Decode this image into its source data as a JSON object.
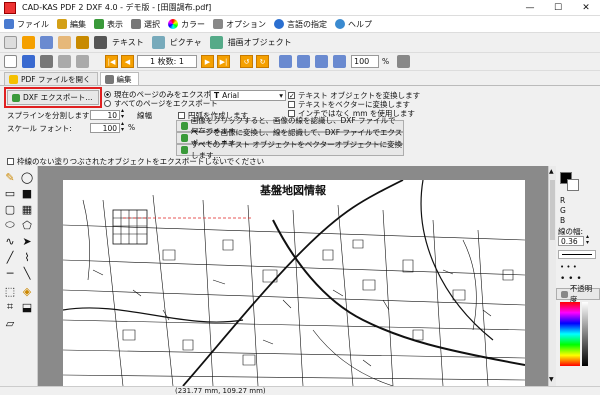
{
  "window": {
    "title": "CAD-KAS PDF 2 DXF 4.0 - デモ版 - [田園調布.pdf]",
    "minimize": "—",
    "maximize": "☐",
    "close": "✕"
  },
  "menu": [
    {
      "label": "ファイル",
      "color": "#4a7bd0"
    },
    {
      "label": "編集",
      "color": "#d4a017"
    },
    {
      "label": "表示",
      "color": "#3a9a3a"
    },
    {
      "label": "選択",
      "color": "#777777"
    },
    {
      "label": "カラー",
      "color": "#d04a4a"
    },
    {
      "label": "オプション",
      "color": "#888888"
    },
    {
      "label": "言語の指定",
      "color": "#2b6fd0"
    },
    {
      "label": "ヘルプ",
      "color": "#3a8ad0"
    }
  ],
  "toolbar1": {
    "text_label": "テキスト",
    "picture_label": "ピクチャ",
    "draw_object_label": "描画オブジェクト"
  },
  "toolbar2": {
    "page_indicator": "1 枚数: 1",
    "zoom": "100",
    "zoom_unit": "%"
  },
  "tabs": [
    {
      "label": "PDF ファイルを開く"
    },
    {
      "label": "編集"
    }
  ],
  "export_panel": {
    "dxf_export_button": "DXF エクスポート...",
    "radio_current_page": "現在のページのみをエクスポートします",
    "radio_all_pages": "すべてのページをエクスポート",
    "spline_label": "スプラインを分割します:",
    "spline_value": "10",
    "scale_font_label": "スケール フォント:",
    "scale_font_value": "100",
    "percent": "%",
    "font_value": "Arial",
    "line_width_label": "線幅",
    "circle_label": "円弧を作成します",
    "check_text_convert": "テキスト オブジェクトを変換します",
    "check_text_vector": "テキストをベクターに変換します",
    "check_inch": "インチではなく mm を使用します",
    "btn_image_trace": "画像をクリックすると、画像の線を認識し、DXF ファイルで保存できます",
    "btn_page_image_trace": "ページを画像に変換し、線を認識して、DXF ファイルでエクスポートします",
    "btn_text_vector": "すべてのテキスト オブジェクトをベクターオブジェクトに変換します...",
    "check_no_frame": "枠線のない塗りつぶされたオブジェクトをエクスポートしないでください"
  },
  "document": {
    "map_title": "基盤地図情報"
  },
  "right_panel": {
    "r_label": "R",
    "g_label": "G",
    "b_label": "B",
    "line_width_label": "線の幅:",
    "line_width_value": "0.36",
    "opacity_label": "不透明度"
  },
  "status": {
    "coords": "(231.77 mm, 109.27 mm)"
  },
  "colors": {
    "highlight": "#e02020",
    "orange": "#f5a000"
  }
}
